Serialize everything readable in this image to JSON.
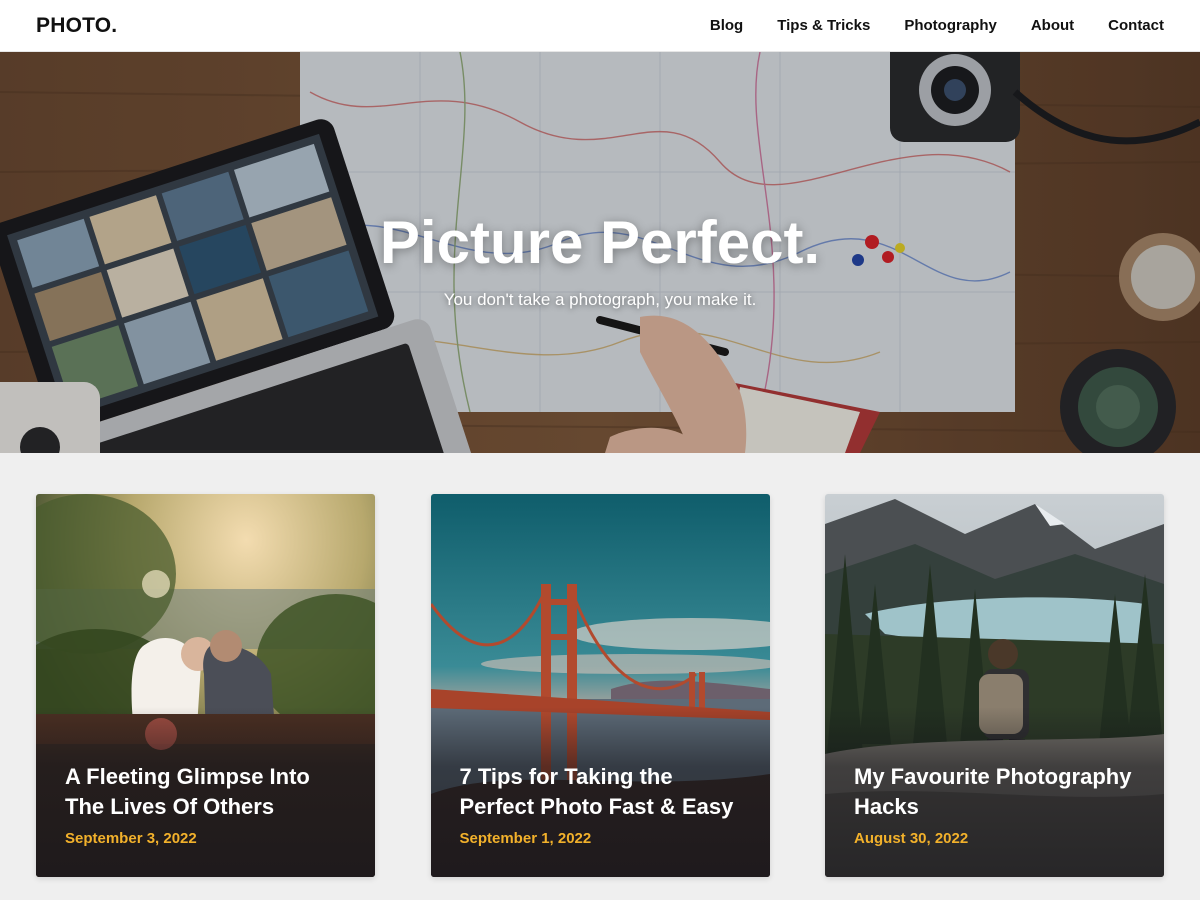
{
  "header": {
    "logo": "PHOTO.",
    "nav": [
      "Blog",
      "Tips & Tricks",
      "Photography",
      "About",
      "Contact"
    ]
  },
  "hero": {
    "title": "Picture Perfect.",
    "subtitle": "You don't take a photograph, you make it."
  },
  "posts": [
    {
      "title": "A Fleeting Glimpse Into The Lives Of Others",
      "date": "September 3, 2022"
    },
    {
      "title": "7 Tips for Taking the Perfect Photo Fast & Easy",
      "date": "September 1, 2022"
    },
    {
      "title": "My Favourite Photography Hacks",
      "date": "August 30, 2022"
    }
  ],
  "colors": {
    "accent_date": "#f2b12b",
    "page_bg": "#efefef",
    "header_bg": "#ffffff"
  }
}
